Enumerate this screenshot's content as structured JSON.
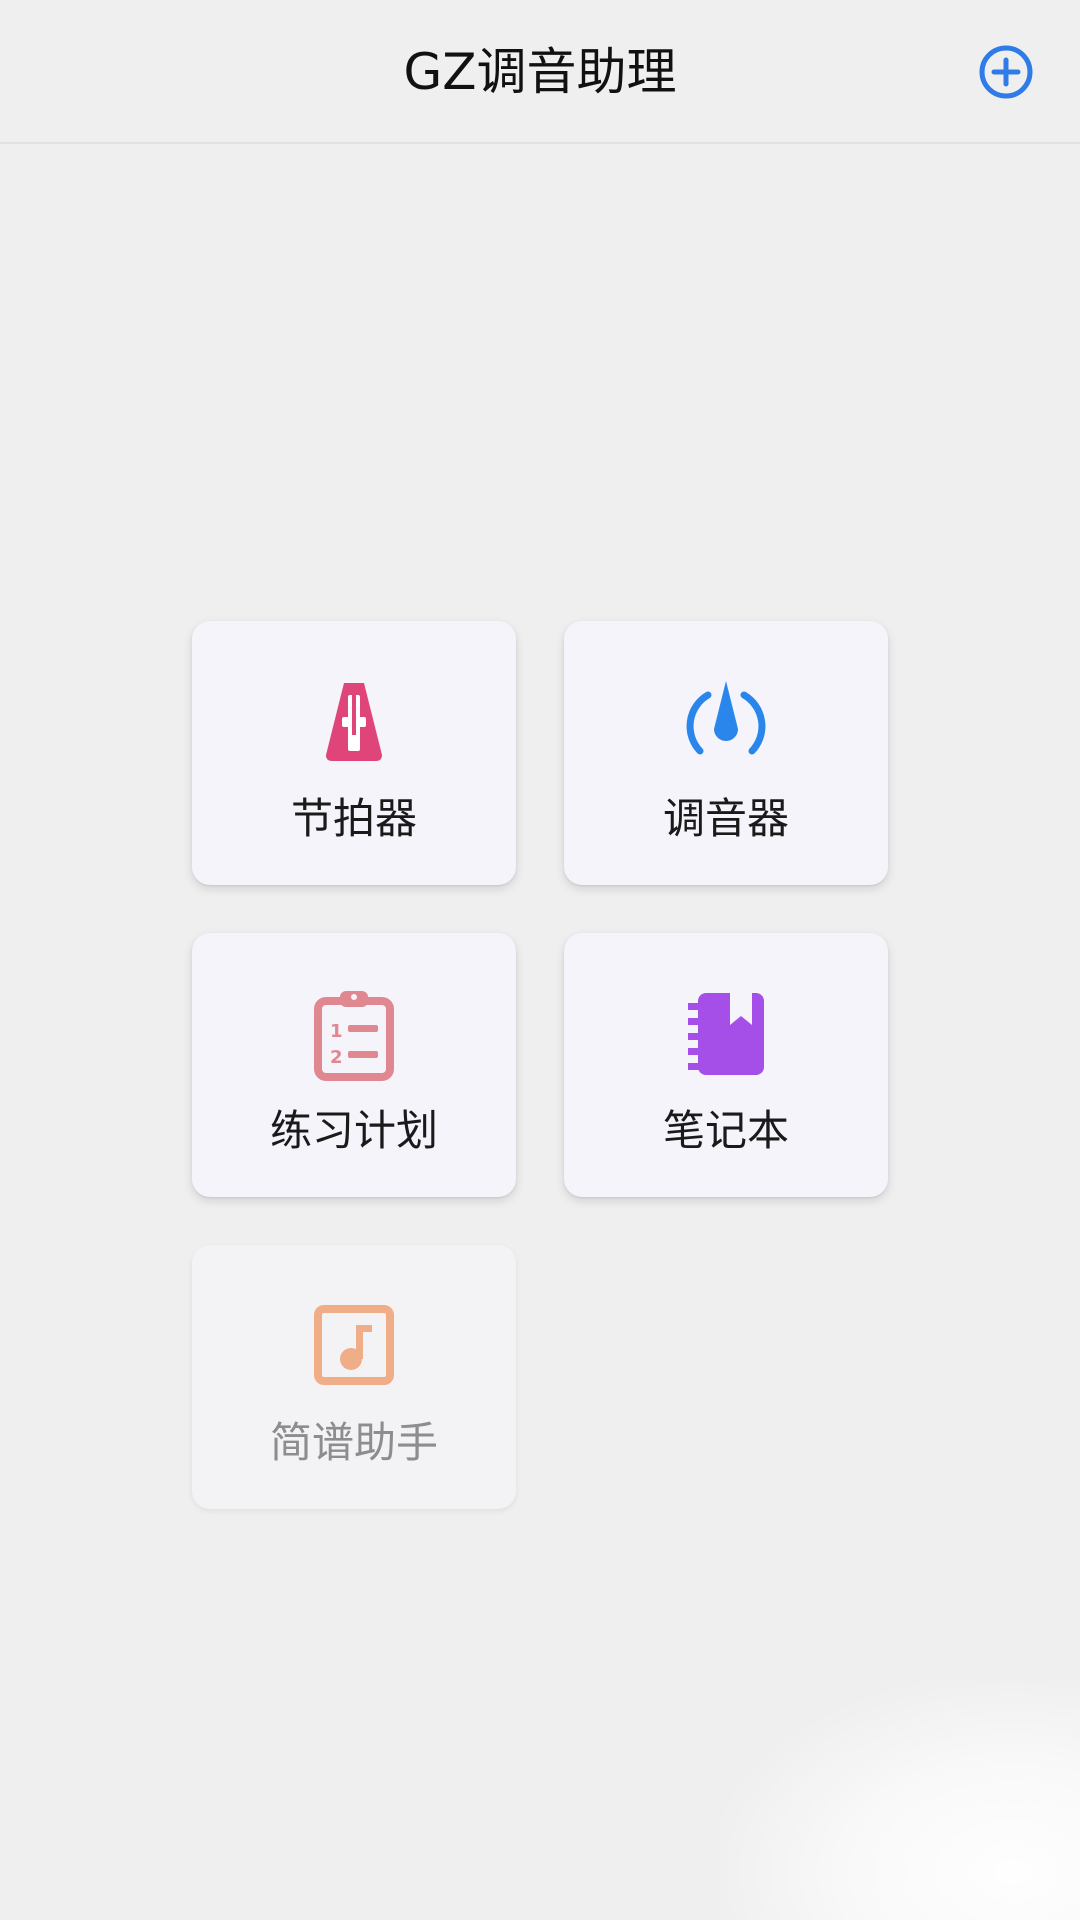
{
  "header": {
    "title": "GZ调音助理",
    "add_icon": "plus-circle-icon",
    "accent_color": "#2f7be8"
  },
  "cards": [
    {
      "label": "节拍器",
      "icon": "metronome-icon",
      "icon_color": "#e0457a",
      "enabled": true
    },
    {
      "label": "调音器",
      "icon": "tuner-gauge-icon",
      "icon_color": "#2a86ea",
      "enabled": true
    },
    {
      "label": "练习计划",
      "icon": "clipboard-list-icon",
      "icon_color": "#e08890",
      "enabled": true
    },
    {
      "label": "笔记本",
      "icon": "notebook-icon",
      "icon_color": "#a54ee8",
      "enabled": true
    },
    {
      "label": "简谱助手",
      "icon": "music-note-icon",
      "icon_color": "#efae88",
      "enabled": false
    }
  ]
}
